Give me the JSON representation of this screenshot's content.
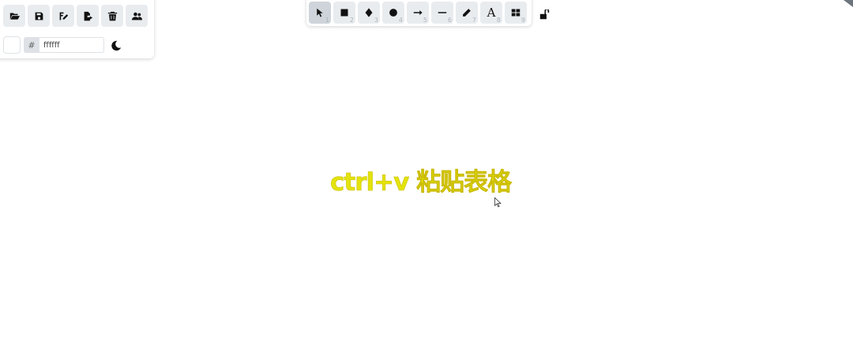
{
  "left_panel": {
    "actions": [
      {
        "name": "open-button",
        "icon": "folder-open-icon"
      },
      {
        "name": "save-button",
        "icon": "save-icon"
      },
      {
        "name": "save-as-button",
        "icon": "pen-file-icon"
      },
      {
        "name": "export-button",
        "icon": "file-export-icon"
      },
      {
        "name": "clear-canvas-button",
        "icon": "trash-icon"
      },
      {
        "name": "collaboration-button",
        "icon": "users-icon"
      }
    ],
    "background": {
      "swatch_color": "#ffffff",
      "hash_label": "#",
      "hex_value": "ffffff"
    },
    "theme_toggle": {
      "icon": "moon-icon"
    }
  },
  "toolbar": {
    "tools": [
      {
        "name": "selection",
        "icon": "pointer-icon",
        "key": "1",
        "selected": true
      },
      {
        "name": "rectangle",
        "icon": "square-icon",
        "key": "2"
      },
      {
        "name": "diamond",
        "icon": "diamond-icon",
        "key": "3"
      },
      {
        "name": "ellipse",
        "icon": "circle-icon",
        "key": "4"
      },
      {
        "name": "arrow",
        "icon": "arrow-right-icon",
        "key": "5"
      },
      {
        "name": "line",
        "icon": "line-icon",
        "key": "6"
      },
      {
        "name": "draw",
        "icon": "pencil-icon",
        "key": "7"
      },
      {
        "name": "text",
        "icon": "text-icon",
        "glyph": "A",
        "key": "8"
      },
      {
        "name": "library",
        "icon": "grid-icon",
        "key": "9"
      }
    ],
    "lock": {
      "icon": "unlock-icon"
    }
  },
  "canvas": {
    "hint_text": "ctrl+v 粘贴表格",
    "hint_color": "#e3e30c"
  }
}
